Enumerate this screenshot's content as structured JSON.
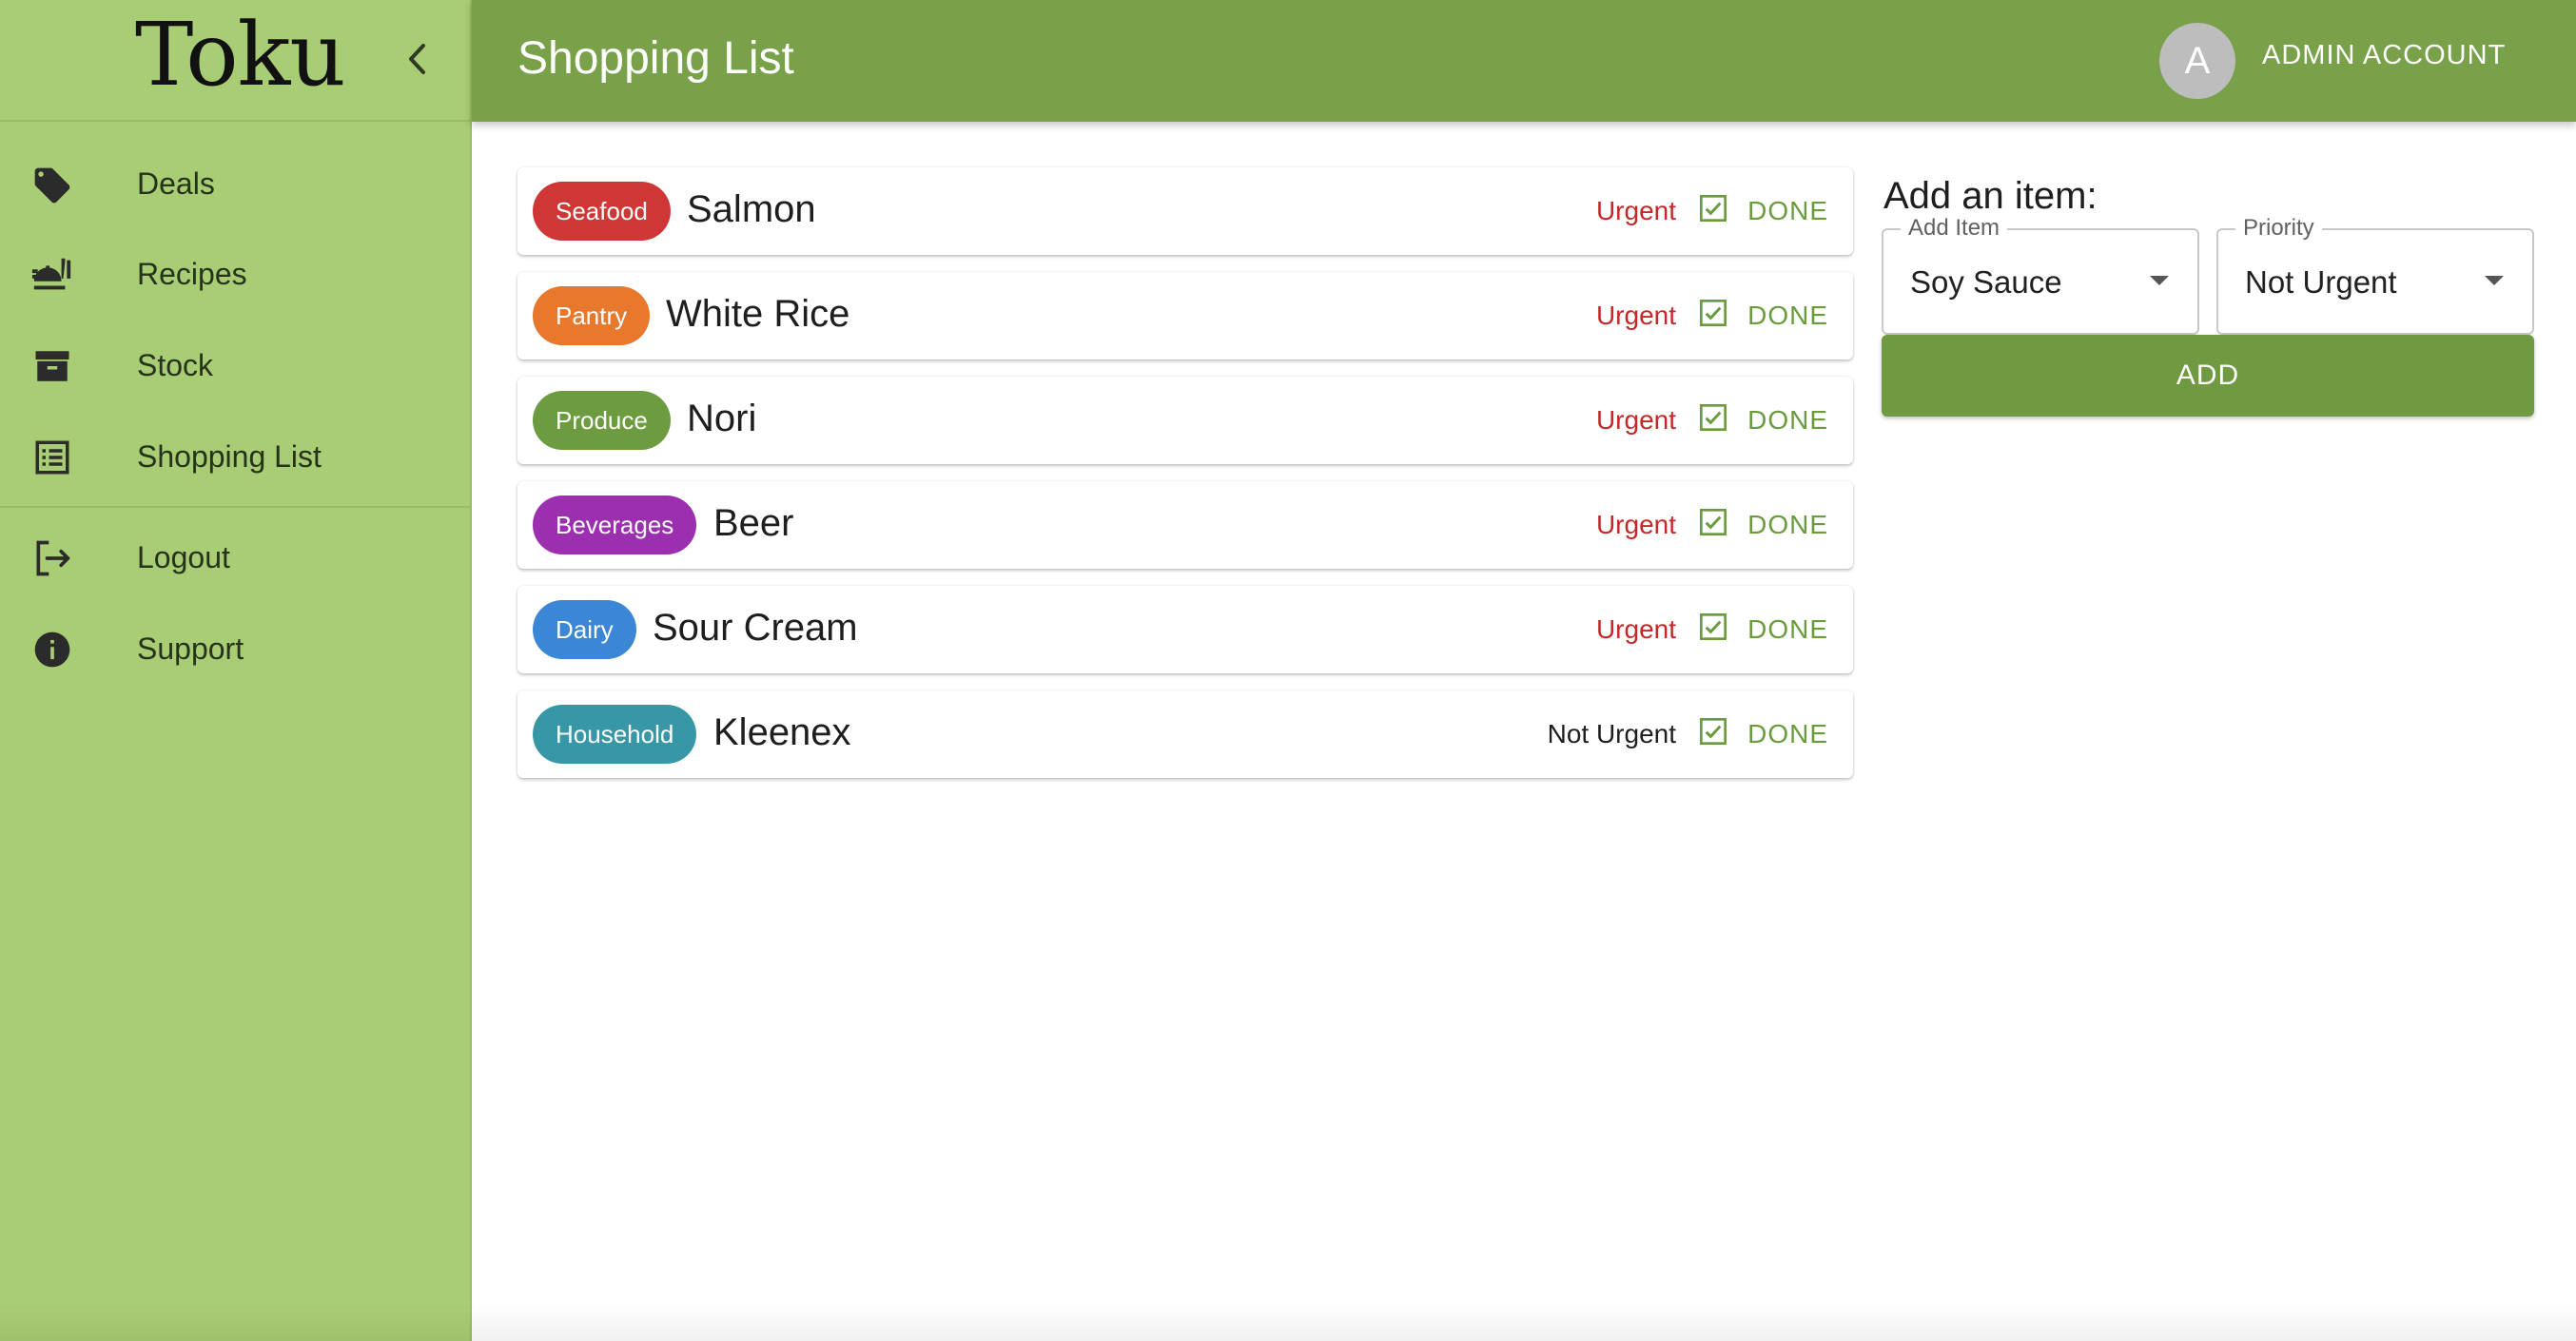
{
  "app": {
    "name": "Toku"
  },
  "sidebar": {
    "items": [
      {
        "label": "Deals",
        "icon": "tag-icon"
      },
      {
        "label": "Recipes",
        "icon": "food-service-icon"
      },
      {
        "label": "Stock",
        "icon": "archive-icon"
      },
      {
        "label": "Shopping List",
        "icon": "list-icon"
      }
    ],
    "secondary": [
      {
        "label": "Logout",
        "icon": "logout-icon"
      },
      {
        "label": "Support",
        "icon": "info-icon"
      }
    ]
  },
  "header": {
    "title": "Shopping List",
    "avatar_letter": "A",
    "account_label": "ADMIN ACCOUNT"
  },
  "colors": {
    "sidebar_bg": "#a9cd74",
    "topbar_bg": "#78a149",
    "urgent": "#c62828",
    "done": "#6a9b3c",
    "add_button": "#6f9a41"
  },
  "list": {
    "done_label": "DONE",
    "items": [
      {
        "category": "Seafood",
        "category_color": "#cf3636",
        "name": "Salmon",
        "priority": "Urgent"
      },
      {
        "category": "Pantry",
        "category_color": "#e8782c",
        "name": "White Rice",
        "priority": "Urgent"
      },
      {
        "category": "Produce",
        "category_color": "#6d9b3f",
        "name": "Nori",
        "priority": "Urgent"
      },
      {
        "category": "Beverages",
        "category_color": "#9b2fb0",
        "name": "Beer",
        "priority": "Urgent"
      },
      {
        "category": "Dairy",
        "category_color": "#3b87d6",
        "name": "Sour Cream",
        "priority": "Urgent"
      },
      {
        "category": "Household",
        "category_color": "#3797a6",
        "name": "Kleenex",
        "priority": "Not Urgent"
      }
    ]
  },
  "add_form": {
    "title": "Add an item:",
    "item_label": "Add Item",
    "item_value": "Soy Sauce",
    "priority_label": "Priority",
    "priority_value": "Not Urgent",
    "add_button": "ADD"
  }
}
